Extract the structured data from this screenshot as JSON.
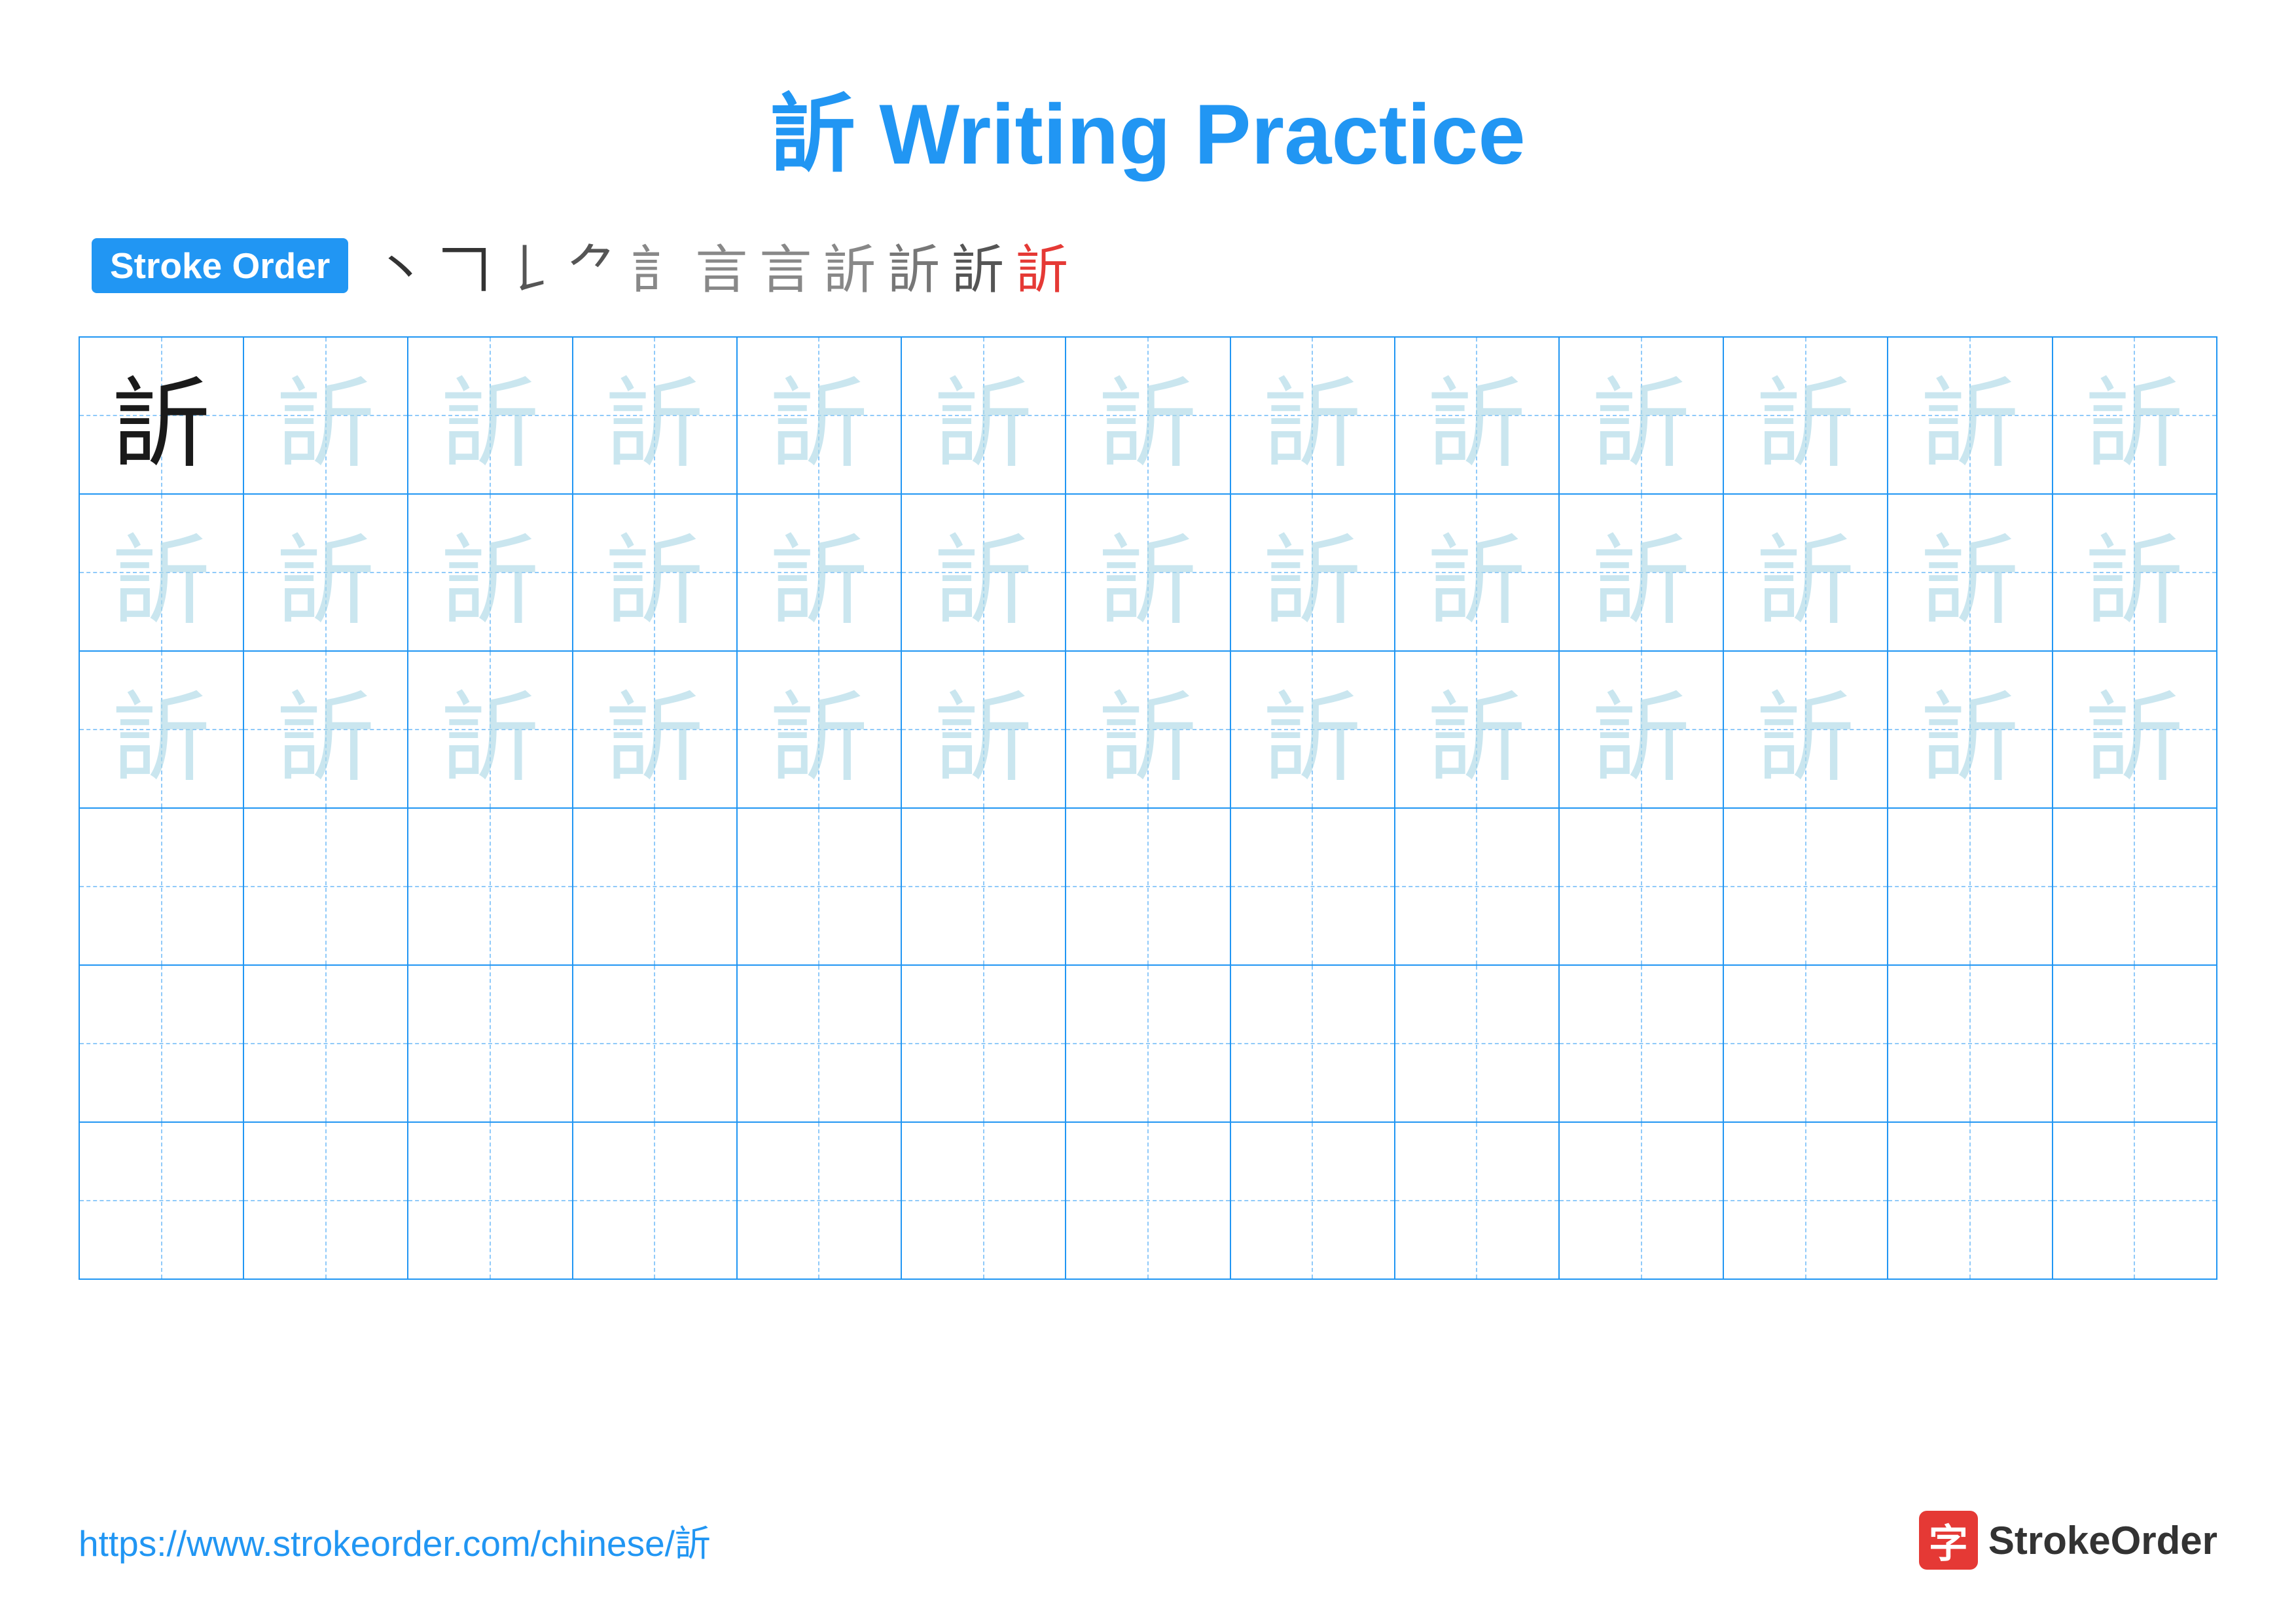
{
  "title": "訢 Writing Practice",
  "stroke_order": {
    "badge_label": "Stroke Order",
    "strokes": [
      "丶",
      "㇀",
      "𠃍",
      "𠃌",
      "𠃋",
      "言",
      "言",
      "訢̈",
      "訢́",
      "訢",
      "訢"
    ]
  },
  "character": "訢",
  "grid": {
    "rows": 6,
    "cols": 13,
    "row_types": [
      "dark_then_light",
      "light",
      "light",
      "empty",
      "empty",
      "empty"
    ]
  },
  "footer": {
    "url": "https://www.strokeorder.com/chinese/訢",
    "logo_icon": "字",
    "logo_text": "StrokeOrder"
  }
}
